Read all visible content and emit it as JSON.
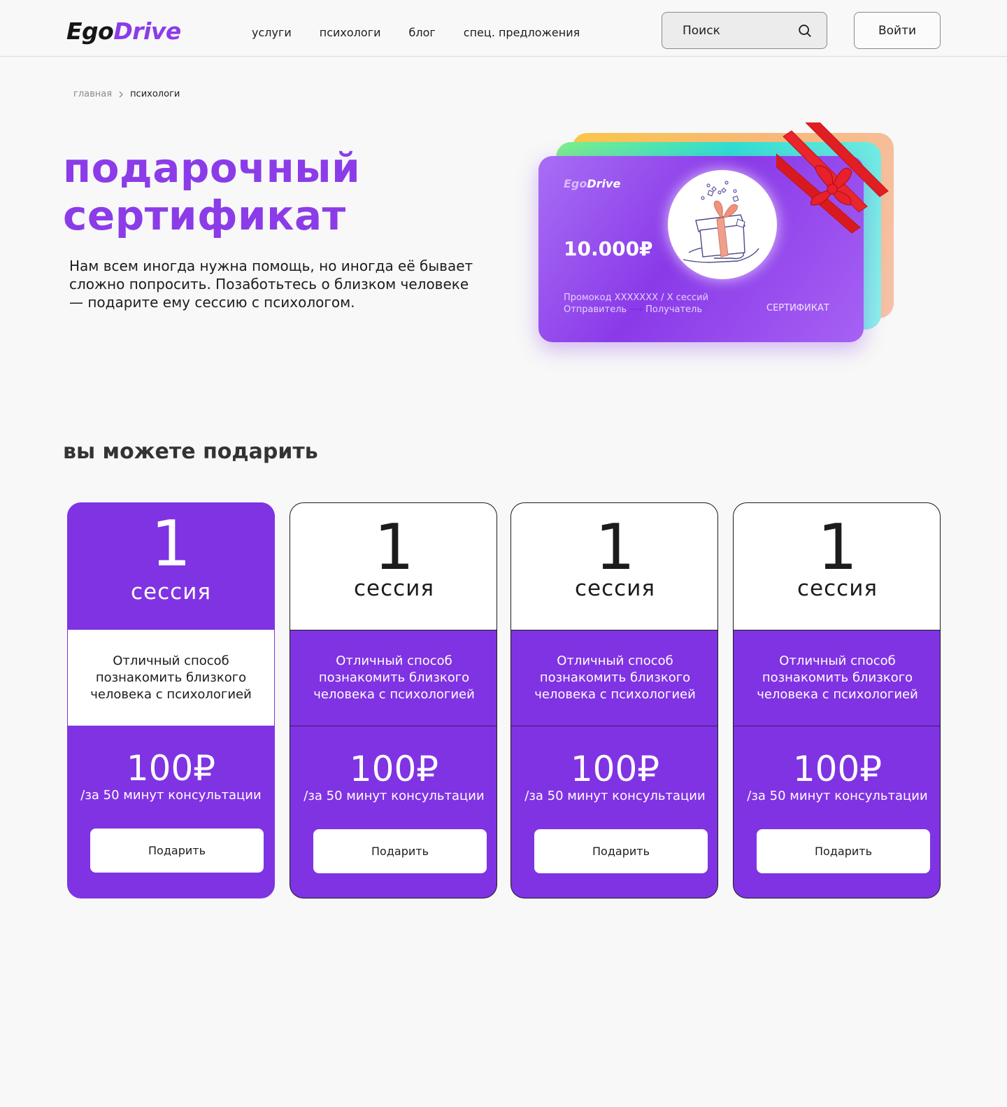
{
  "header": {
    "logo_part1": "Ego",
    "logo_part2": "Drive",
    "nav": [
      "услуги",
      "психологи",
      "блог",
      "спец. предложения"
    ],
    "search_placeholder": "Поиск",
    "login_label": "Войти"
  },
  "breadcrumb": {
    "home": "главная",
    "current": "психологи"
  },
  "hero": {
    "title_line1": "подарочный",
    "title_line2": "сертификат",
    "text": "Нам всем иногда нужна помощь, но иногда её бывает сложно попросить. Позаботьтесь о близком человеке — подарите ему сессию с психологом."
  },
  "certificate": {
    "logo_part1": "Ego",
    "logo_part2": "Drive",
    "amount": "10.000₽",
    "promo": "Промокод XXXXXXX / X сессий",
    "sender": "Отправитель",
    "arrow": "⟶",
    "receiver": "Получатель",
    "label": "СЕРТИФИКАТ"
  },
  "section": {
    "title": "вы можете подарить"
  },
  "cards": [
    {
      "count": "1",
      "unit": "сессия",
      "description": "Отличный способ познакомить близкого человека с психологией",
      "price": "100₽",
      "per": "/за 50 минут консультации",
      "button": "Подарить",
      "variant": "a"
    },
    {
      "count": "1",
      "unit": "сессия",
      "description": "Отличный способ познакомить близкого человека с психологией",
      "price": "100₽",
      "per": "/за 50 минут консультации",
      "button": "Подарить",
      "variant": "b"
    },
    {
      "count": "1",
      "unit": "сессия",
      "description": "Отличный способ познакомить близкого человека с психологией",
      "price": "100₽",
      "per": "/за 50 минут консультации",
      "button": "Подарить",
      "variant": "b"
    },
    {
      "count": "1",
      "unit": "сессия",
      "description": "Отличный способ познакомить близкого человека с психологией",
      "price": "100₽",
      "per": "/за 50 минут консультации",
      "button": "Подарить",
      "variant": "b"
    }
  ],
  "colors": {
    "brand": "#8b3ce8",
    "card_purple": "#8033e3"
  },
  "icons": [
    "search-icon",
    "chevron-right-icon",
    "gift-icon",
    "ribbon-bow-icon"
  ]
}
